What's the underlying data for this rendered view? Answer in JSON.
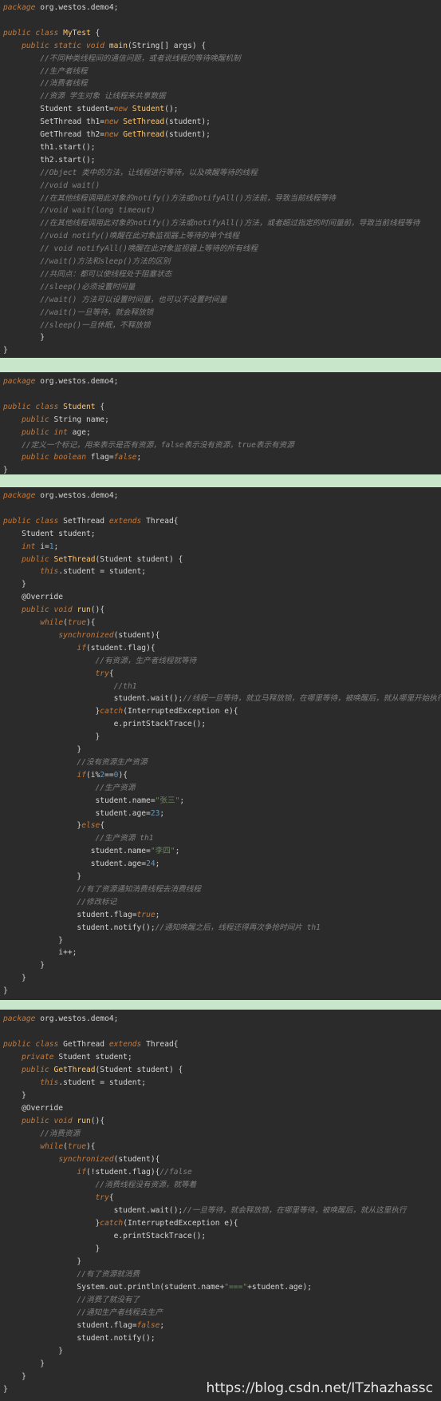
{
  "watermark": "https://blog.csdn.net/ITzhazhassc",
  "colors": {
    "background": "#2b2b2b",
    "keyword": "#cc7832",
    "comment": "#808080",
    "string": "#6a8759",
    "number": "#6897bb",
    "method": "#ffc66d",
    "separator": "#c8e6c9"
  },
  "panels": [
    {
      "name": "mytest",
      "lines": [
        "package org.westos.demo4;",
        "",
        "public class MyTest {",
        "    public static void main(String[] args) {",
        "        //不同种类线程间的通信问题，或者说线程的等待唤醒机制",
        "        //生产者线程",
        "        //消费者线程",
        "        //资源 学生对象 让线程来共享数据",
        "        Student student=new Student();",
        "        SetThread th1=new SetThread(student);",
        "        GetThread th2=new GetThread(student);",
        "        th1.start();",
        "        th2.start();",
        "        //Object 类中的方法，让线程进行等待，以及唤醒等待的线程",
        "        //void wait()",
        "        //在其他线程调用此对象的notify()方法或notifyAll()方法前，导致当前线程等待",
        "        //void wait(long timeout)",
        "        //在其他线程调用此对象的notify()方法或notifyAll()方法，或者超过指定的时间量前，导致当前线程等待",
        "        //void notify()唤醒在此对象监视器上等待的单个线程",
        "        // void notifyAll()唤醒在此对象监视器上等待的所有线程",
        "        //wait()方法和sleep()方法的区别",
        "        //共同点：都可以使线程处于阻塞状态",
        "        //sleep()必须设置时间量",
        "        //wait() 方法可以设置时间量，也可以不设置时间量",
        "        //wait()一旦等待，就会释放锁",
        "        //sleep()一旦休眠，不释放锁",
        "        }",
        "}"
      ]
    },
    {
      "name": "student",
      "lines": [
        "package org.westos.demo4;",
        "",
        "public class Student {",
        "    public String name;",
        "    public int age;",
        "    //定义一个标记，用来表示是否有资源，false表示没有资源，true表示有资源",
        "    public boolean flag=false;",
        "}"
      ]
    },
    {
      "name": "setthread",
      "lines": [
        "package org.westos.demo4;",
        "",
        "public class SetThread extends Thread{",
        "    Student student;",
        "    int i=1;",
        "    public SetThread(Student student) {",
        "        this.student = student;",
        "    }",
        "    @Override",
        "    public void run(){",
        "        while(true){",
        "            synchronized(student){",
        "                if(student.flag){",
        "                    //有资源，生产者线程就等待",
        "                    try{",
        "                        //th1",
        "                        student.wait();//线程一旦等待，就立马释放锁，在哪里等待，被唤醒后，就从哪里开始执行",
        "                    }catch(InterruptedException e){",
        "                        e.printStackTrace();",
        "                    }",
        "                }",
        "                //没有资源生产资源",
        "                if(i%2==0){",
        "                    //生产资源",
        "                    student.name=\"张三\";",
        "                    student.age=23;",
        "                }else{",
        "                    //生产资源 th1",
        "                   student.name=\"李四\";",
        "                   student.age=24;",
        "                }",
        "                //有了资源通知消费线程去消费线程",
        "                //修改标记",
        "                student.flag=true;",
        "                student.notify();//通知唤醒之后，线程还得再次争抢时间片 th1",
        "            }",
        "            i++;",
        "        }",
        "    }",
        "}"
      ]
    },
    {
      "name": "getthread",
      "lines": [
        "package org.westos.demo4;",
        "",
        "public class GetThread extends Thread{",
        "    private Student student;",
        "    public GetThread(Student student) {",
        "        this.student = student;",
        "    }",
        "    @Override",
        "    public void run(){",
        "        //消费资源",
        "        while(true){",
        "            synchronized(student){",
        "                if(!student.flag){//false",
        "                    //消费线程没有资源，就等着",
        "                    try{",
        "                        student.wait();//一旦等待，就会释放锁，在哪里等待，被唤醒后，就从这里执行",
        "                    }catch(InterruptedException e){",
        "                        e.printStackTrace();",
        "                    }",
        "                }",
        "                //有了资源就消费",
        "                System.out.println(student.name+\"===\"+student.age);",
        "                //消费了就没有了",
        "                //通知生产者线程去生产",
        "                student.flag=false;",
        "                student.notify();",
        "            }",
        "        }",
        "    }",
        "}"
      ]
    }
  ]
}
